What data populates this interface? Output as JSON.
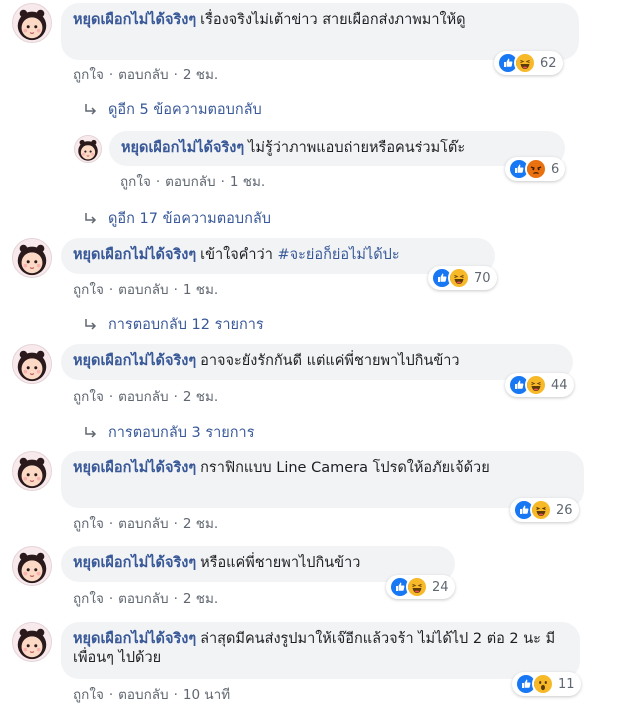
{
  "actions": {
    "like": "ถูกใจ",
    "reply": "ตอบกลับ",
    "dot": "·"
  },
  "comments": [
    {
      "author": "หยุดเผือกไม่ได้จริงๆ",
      "text": "เรื่องจริงไม่เต้าข่าว สายเผือกส่งภาพมาให้ดู",
      "time": "2 ชม.",
      "reactions": [
        "like-icon",
        "haha-icon"
      ],
      "count": "62"
    },
    {
      "author": "หยุดเผือกไม่ได้จริงๆ",
      "text": "ไม่รู้ว่าภาพแอบถ่ายหรือคนร่วมโต๊ะ",
      "time": "1 ชม.",
      "reactions": [
        "like-icon",
        "angry-icon"
      ],
      "count": "6"
    },
    {
      "author": "หยุดเผือกไม่ได้จริงๆ",
      "text": "เข้าใจคำว่า ",
      "hashtag": "#จะย่อก็ย่อไม่ได้ปะ",
      "time": "1 ชม.",
      "reactions": [
        "like-icon",
        "haha-icon"
      ],
      "count": "70"
    },
    {
      "author": "หยุดเผือกไม่ได้จริงๆ",
      "text": "อาจจะยังรักกันดี แต่แค่พี่ชายพาไปกินข้าว",
      "time": "2 ชม.",
      "reactions": [
        "like-icon",
        "haha-icon"
      ],
      "count": "44"
    },
    {
      "author": "หยุดเผือกไม่ได้จริงๆ",
      "text": "กราฟิกแบบ Line Camera โปรดให้อภัยเจ้ด้วย",
      "time": "2 ชม.",
      "reactions": [
        "like-icon",
        "haha-icon"
      ],
      "count": "26"
    },
    {
      "author": "หยุดเผือกไม่ได้จริงๆ",
      "text": "หรือแค่พี่ชายพาไปกินข้าว",
      "time": "2 ชม.",
      "reactions": [
        "like-icon",
        "haha-icon"
      ],
      "count": "24"
    },
    {
      "author": "หยุดเผือกไม่ได้จริงๆ",
      "text": "ล่าสุดมีคนส่งรูปมาให้เจ๊อีกแล้วจร้า ไม่ได้ไป 2 ต่อ 2 นะ มีเพื่อนๆ ไปด้วย",
      "time": "10 นาที",
      "reactions": [
        "like-icon",
        "wow-icon"
      ],
      "count": "11"
    }
  ],
  "more_replies": [
    "ดูอีก 5 ข้อความตอบกลับ",
    "ดูอีก 17 ข้อความตอบกลับ",
    "การตอบกลับ 12 รายการ",
    "การตอบกลับ 3 รายการ"
  ],
  "colors": {
    "link": "#385898",
    "bubble": "#f2f3f5",
    "meta": "#606770",
    "like": "#1877f2",
    "haha": "#f7b928",
    "angry": "#e9710f"
  }
}
